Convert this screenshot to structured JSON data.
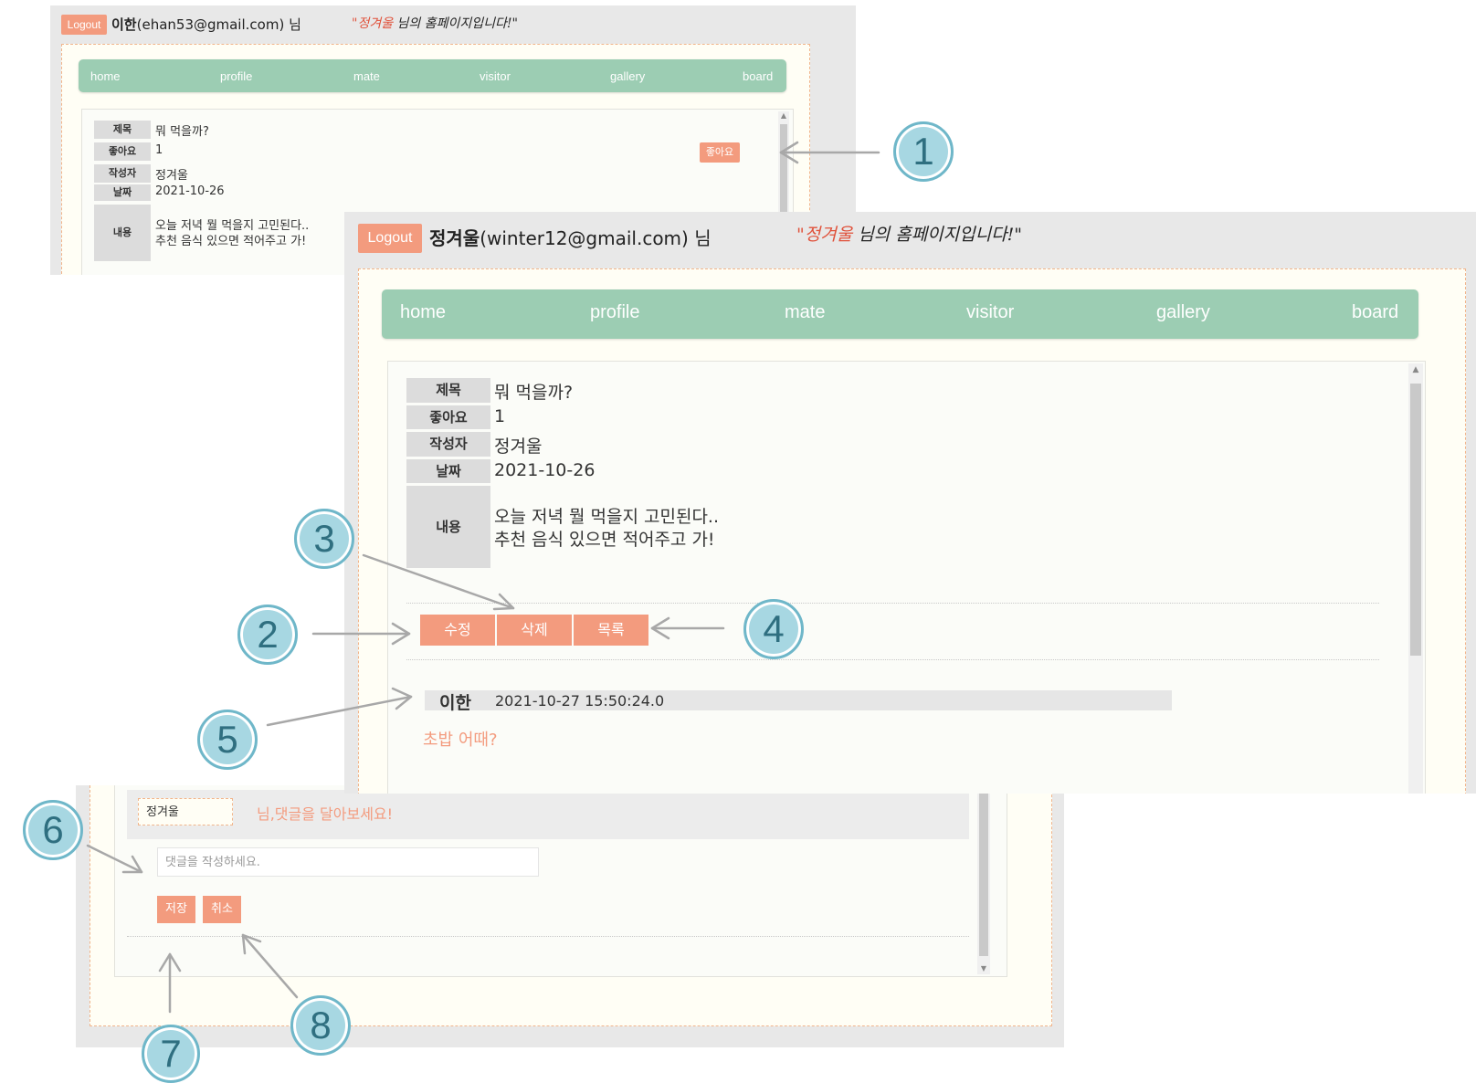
{
  "small_top": {
    "header": {
      "logout_label": "Logout",
      "user_name": "이한",
      "user_email": "(ehan53@gmail.com) 님",
      "slogan_hl": "\"정겨울",
      "slogan_rest": " 님의 홈페이지입니다!\""
    },
    "nav": [
      "home",
      "profile",
      "mate",
      "visitor",
      "gallery",
      "board"
    ],
    "post": {
      "title_label": "제목",
      "title": "뭐 먹을까?",
      "likes_label": "좋아요",
      "likes": "1",
      "author_label": "작성자",
      "author": "정겨울",
      "date_label": "날짜",
      "date": "2021-10-26",
      "content_label": "내용",
      "content_line1": "오늘 저녁 뭘 먹을지 고민된다..",
      "content_line2": "추천 음식 있으면 적어주고 가!"
    },
    "like_button": "좋아요"
  },
  "main": {
    "header": {
      "logout_label": "Logout",
      "user_name": "정겨울",
      "user_email": "(winter12@gmail.com) 님",
      "slogan_hl": "\"정겨울",
      "slogan_rest": " 님의 홈페이지입니다!\""
    },
    "nav": [
      "home",
      "profile",
      "mate",
      "visitor",
      "gallery",
      "board"
    ],
    "post": {
      "title_label": "제목",
      "title": "뭐 먹을까?",
      "likes_label": "좋아요",
      "likes": "1",
      "author_label": "작성자",
      "author": "정겨울",
      "date_label": "날짜",
      "date": "2021-10-26",
      "content_label": "내용",
      "content_line1": "오늘 저녁 뭘 먹을지 고민된다..",
      "content_line2": "추천 음식 있으면 적어주고 가!"
    },
    "buttons": {
      "edit": "수정",
      "delete": "삭제",
      "list": "목록"
    },
    "comment": {
      "author": "이한",
      "timestamp": "2021-10-27 15:50:24.0",
      "text": "초밥 어때?"
    }
  },
  "small_bottom": {
    "writer_name": "정겨울",
    "prompt": "님,댓글을 달아보세요!",
    "comment_placeholder": "댓글을 작성하세요.",
    "save_label": "저장",
    "cancel_label": "취소"
  },
  "callouts": [
    "1",
    "2",
    "3",
    "4",
    "5",
    "6",
    "7",
    "8"
  ],
  "colors": {
    "accent": "#f39b7e",
    "nav": "#9ccdb3",
    "callout_fill": "#a7d7e2",
    "callout_border": "#6fb7c9",
    "frame_bg": "#fffef5"
  }
}
